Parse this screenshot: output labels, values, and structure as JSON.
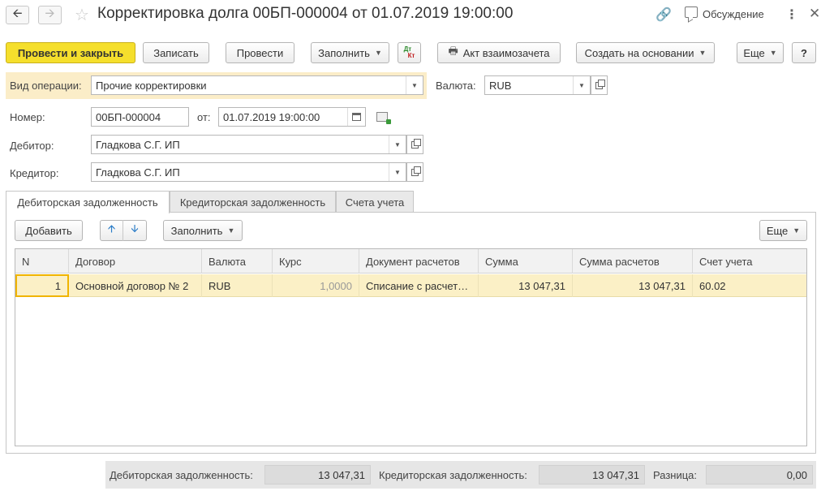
{
  "window": {
    "title": "Корректировка долга 00БП-000004 от 01.07.2019 19:00:00",
    "discussion_label": "Обсуждение"
  },
  "toolbar": {
    "post_close_label": "Провести и закрыть",
    "save_label": "Записать",
    "post_label": "Провести",
    "fill_label": "Заполнить",
    "dt_label": "Дт",
    "kt_label": "Кт",
    "act_label": "Акт взаимозачета",
    "create_based_label": "Создать на основании",
    "more_label": "Еще",
    "help_label": "?"
  },
  "form": {
    "operation_type_label": "Вид операции:",
    "operation_type_value": "Прочие корректировки",
    "currency_label": "Валюта:",
    "currency_value": "RUB",
    "number_label": "Номер:",
    "number_value": "00БП-000004",
    "date_label": "от:",
    "date_value": "01.07.2019 19:00:00",
    "debtor_label": "Дебитор:",
    "debtor_value": "Гладкова С.Г. ИП",
    "creditor_label": "Кредитор:",
    "creditor_value": "Гладкова С.Г. ИП"
  },
  "tabs": [
    {
      "label": "Дебиторская задолженность",
      "active": true
    },
    {
      "label": "Кредиторская задолженность",
      "active": false
    },
    {
      "label": "Счета учета",
      "active": false
    }
  ],
  "table_toolbar": {
    "add_label": "Добавить",
    "fill_label": "Заполнить",
    "more_label": "Еще"
  },
  "table": {
    "columns": [
      "N",
      "Договор",
      "Валюта",
      "Курс",
      "Документ расчетов",
      "Сумма",
      "Сумма расчетов",
      "Счет учета"
    ],
    "rows": [
      {
        "n": "1",
        "contract": "Основной договор № 2",
        "currency": "RUB",
        "rate": "1,0000",
        "document": "Списание с расчет…",
        "amount": "13 047,31",
        "settlement_amount": "13 047,31",
        "account": "60.02"
      }
    ]
  },
  "totals": {
    "receivable_label": "Дебиторская задолженность:",
    "receivable_value": "13 047,31",
    "payable_label": "Кредиторская задолженность:",
    "payable_value": "13 047,31",
    "difference_label": "Разница:",
    "difference_value": "0,00"
  }
}
